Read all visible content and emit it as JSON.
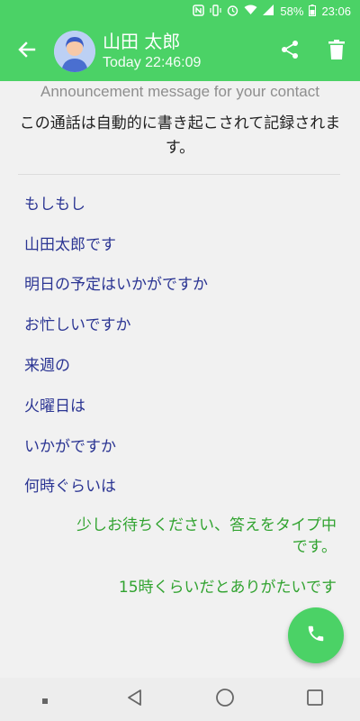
{
  "status_bar": {
    "battery": "58%",
    "time": "23:06",
    "icons": [
      "nfc-icon",
      "vibrate-icon",
      "alarm-icon",
      "wifi-icon",
      "signal-icon",
      "battery-icon"
    ]
  },
  "header": {
    "contact_name": "山田 太郎",
    "timestamp": "Today 22:46:09",
    "icons": [
      "back-arrow-icon",
      "share-icon",
      "trash-icon"
    ]
  },
  "announcement": {
    "label": "Announcement message for your contact",
    "text": "この通話は自動的に書き起こされて記録されます。"
  },
  "messages": [
    {
      "from": "contact",
      "text": "もしもし"
    },
    {
      "from": "contact",
      "text": "山田太郎です"
    },
    {
      "from": "contact",
      "text": "明日の予定はいかがですか"
    },
    {
      "from": "contact",
      "text": "お忙しいですか"
    },
    {
      "from": "contact",
      "text": "来週の"
    },
    {
      "from": "contact",
      "text": "火曜日は"
    },
    {
      "from": "contact",
      "text": "いかがですか"
    },
    {
      "from": "contact",
      "text": "何時ぐらいは"
    },
    {
      "from": "me",
      "text": "少しお待ちください、答えをタイプ中です。"
    },
    {
      "from": "me",
      "text": "15時くらいだとありがたいです"
    }
  ],
  "colors": {
    "accent": "#4bd266",
    "incoming_text": "#2b3593",
    "outgoing_text": "#31a330"
  }
}
